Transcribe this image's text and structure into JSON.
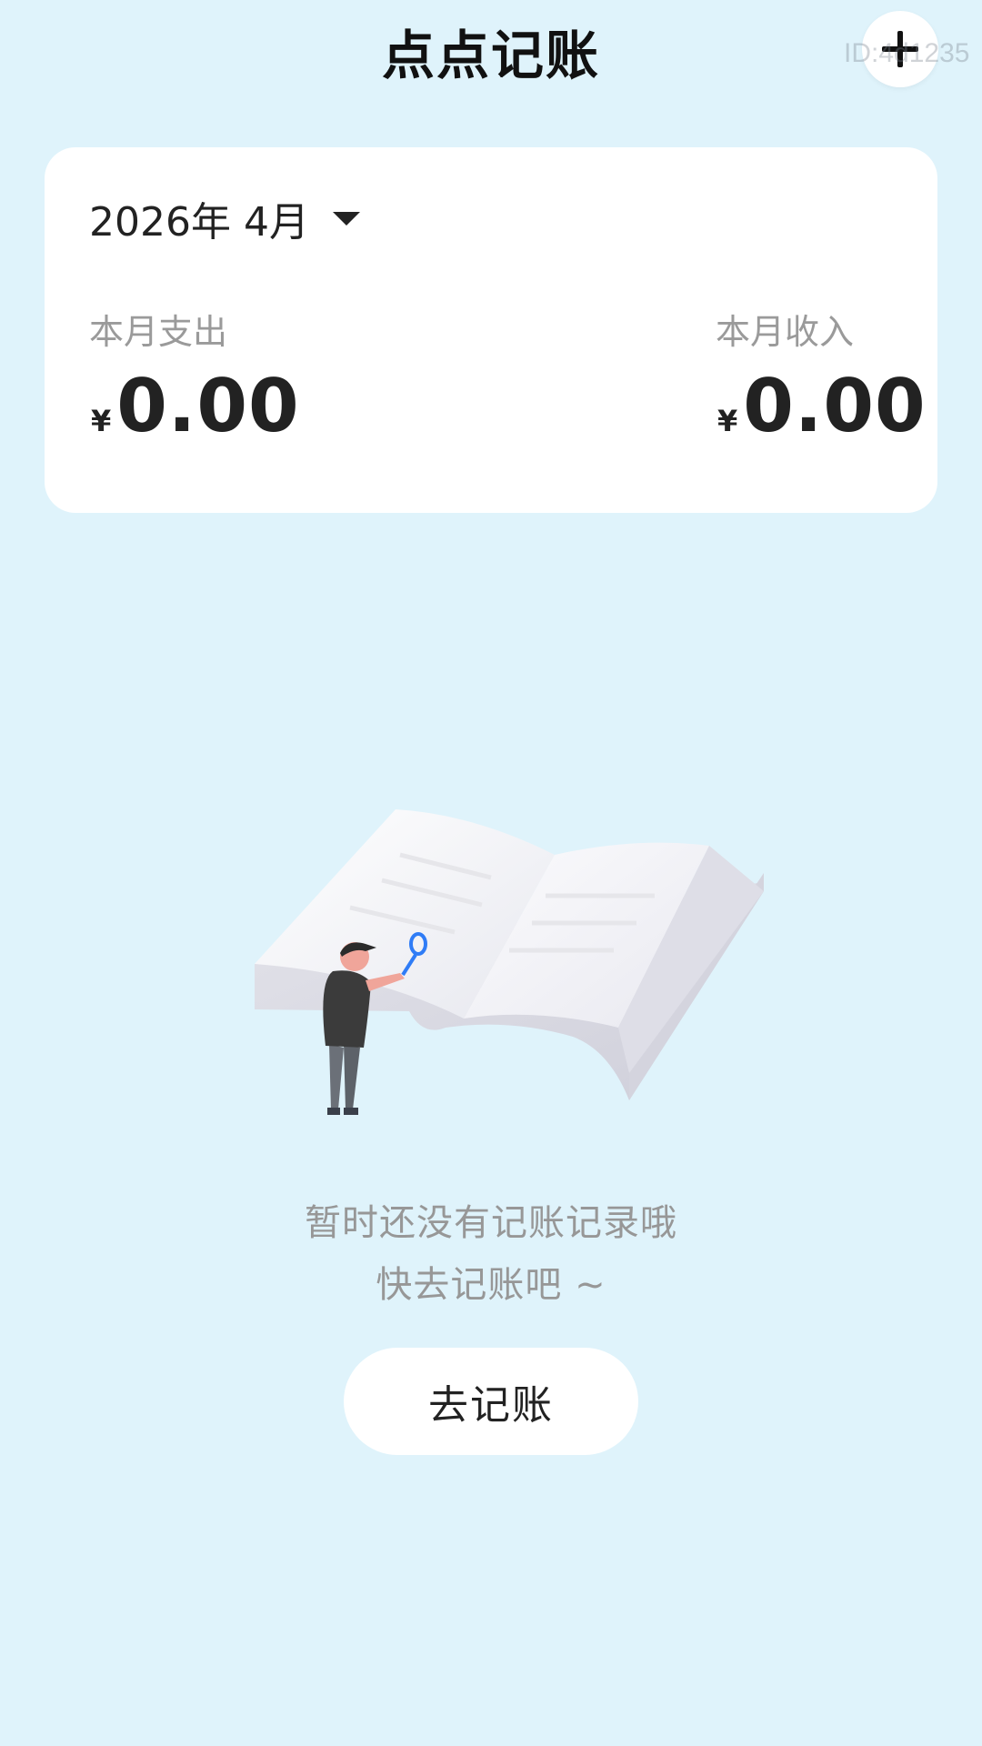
{
  "header": {
    "title": "点点记账",
    "add_icon": "plus-icon",
    "watermark": "ID:4d1235"
  },
  "summary": {
    "month_label": "2026年 4月",
    "month_icon": "caret-down-icon",
    "expense": {
      "label": "本月支出",
      "currency": "¥",
      "amount": "0.00"
    },
    "income": {
      "label": "本月收入",
      "currency": "¥",
      "amount": "0.00"
    }
  },
  "empty_state": {
    "illustration": "open-book-illustration",
    "line1": "暂时还没有记账记录哦",
    "line2": "快去记账吧 ~",
    "button_label": "去记账"
  },
  "colors": {
    "background": "#dff3fb",
    "card": "#ffffff",
    "accent_blue": "#2f7cf6",
    "muted_text": "#979797"
  }
}
